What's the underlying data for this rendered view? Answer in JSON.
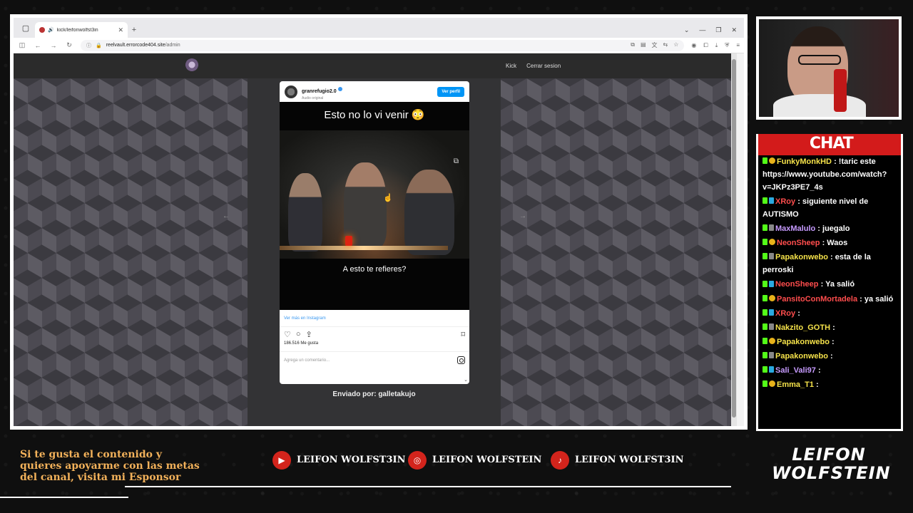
{
  "browser": {
    "tab_title": "kick/leifonwolfst3in",
    "url_host": "reelvault.errorcode404.site",
    "url_path": "/admin"
  },
  "site": {
    "nav_links": [
      "Kick",
      "Cerrar sesion"
    ],
    "sent_by": "Enviado por: galletakujo"
  },
  "instagram": {
    "username": "granrefugio2.0",
    "subtitle": "Audio original",
    "profile_button": "Ver perfil",
    "caption_top": "Esto no lo vi venir 😳",
    "caption_bottom": "A esto te refieres?",
    "more_link": "Ver más en Instagram",
    "likes": "186.516 Me gusta",
    "comment_placeholder": "Agrega un comentario..."
  },
  "chat": {
    "title": "CHAT",
    "messages": [
      {
        "user": "FunkyMonkHD",
        "color": "#f5e24a",
        "text": ": !taric este https://www.youtube.com/watch?v=JKPz3PE7_4s"
      },
      {
        "user": "XRoy",
        "color": "#ff4d4d",
        "text": ": siguiente nivel de AUTISMO"
      },
      {
        "user": "MaxMalulo",
        "color": "#c79bff",
        "text": ": juegalo"
      },
      {
        "user": "NeonSheep",
        "color": "#ff4d4d",
        "text": ": Waos"
      },
      {
        "user": "Papakonwebo",
        "color": "#f5e24a",
        "text": ": esta de la perroski"
      },
      {
        "user": "NeonSheep",
        "color": "#ff4d4d",
        "text": ": Ya salió"
      },
      {
        "user": "PansitoConMortadela",
        "color": "#ff4d4d",
        "text": ": ya salió"
      },
      {
        "user": "XRoy",
        "color": "#ff4d4d",
        "text": ":"
      },
      {
        "user": "Nakzito_GOTH",
        "color": "#f5e24a",
        "text": ":"
      },
      {
        "user": "Papakonwebo",
        "color": "#f5e24a",
        "text": ":"
      },
      {
        "user": "Papakonwebo",
        "color": "#f5e24a",
        "text": ":"
      },
      {
        "user": "Sali_Vali97",
        "color": "#c79bff",
        "text": ":"
      },
      {
        "user": "Emma_T1",
        "color": "#f5e24a",
        "text": ":"
      }
    ]
  },
  "overlay": {
    "sponsor_text": "Si te gusta el contenido y quieres apoyarme con las metas del canal, visita mi Esponsor",
    "socials": [
      {
        "icon": "youtube-icon",
        "name": "LEIFON WOLFST3IN"
      },
      {
        "icon": "instagram-icon",
        "name": "LEIFON WOLFSTEIN"
      },
      {
        "icon": "tiktok-icon",
        "name": "LEIFON WOLFST3IN"
      }
    ],
    "logo": "LEIFON WOLFSTEIN"
  }
}
